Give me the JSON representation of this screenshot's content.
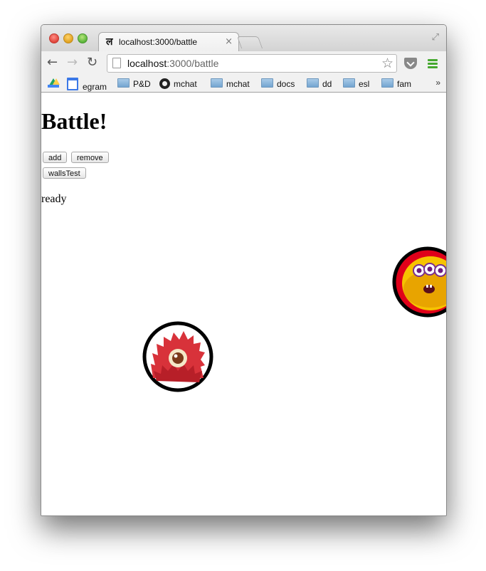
{
  "browser": {
    "tab_title": "localhost:3000/battle",
    "tab_close": "×",
    "favicon_glyph": "ल",
    "url_host": "localhost",
    "url_rest": ":3000/battle",
    "bookmarks_overflow": "»",
    "bookmarks": [
      {
        "label": "egram",
        "icon": "calendar-icon"
      },
      {
        "label": "P&D",
        "icon": "folder-icon"
      },
      {
        "label": "mchat",
        "icon": "github-icon"
      },
      {
        "label": "mchat",
        "icon": "folder-icon"
      },
      {
        "label": "docs",
        "icon": "folder-icon"
      },
      {
        "label": "dd",
        "icon": "folder-icon"
      },
      {
        "label": "esl",
        "icon": "folder-icon"
      },
      {
        "label": "fam",
        "icon": "folder-icon"
      }
    ]
  },
  "page": {
    "heading": "Battle!",
    "buttons": {
      "add": "add",
      "remove": "remove",
      "walls_test": "wallsTest"
    },
    "status": "ready"
  },
  "sprites": [
    {
      "name": "red-furry-monster",
      "color": "#d8323a"
    },
    {
      "name": "yellow-three-eyed-monster",
      "color": "#f6c300"
    }
  ]
}
